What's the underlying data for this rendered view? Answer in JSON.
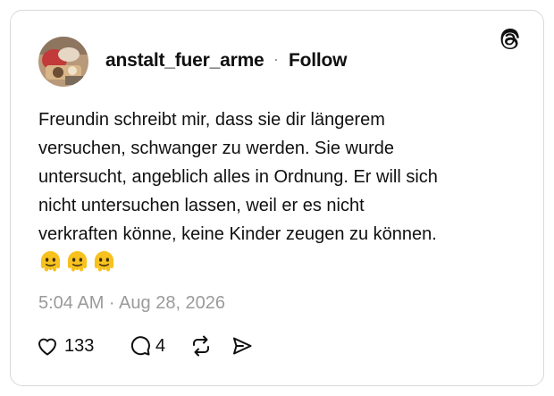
{
  "post": {
    "username": "anstalt_fuer_arme",
    "separator": "·",
    "follow_label": "Follow",
    "avatar_icon": "avatar-photo",
    "brand_icon": "threads-logo-icon",
    "text_lines": [
      "Freundin schreibt mir, dass sie dir längerem",
      "versuchen, schwanger zu werden. Sie wurde",
      "untersucht, angeblich alles in Ordnung. Er will sich",
      "nicht untersuchen lassen, weil er es nicht",
      "verkraften könne, keine Kinder zeugen zu können."
    ],
    "emojis": [
      "melting-face-emoji",
      "melting-face-emoji",
      "melting-face-emoji"
    ],
    "timestamp": "5:04 AM · Aug 28, 2026"
  },
  "actions": {
    "like_count": "133",
    "reply_count": "4",
    "like_icon": "heart-icon",
    "reply_icon": "speech-bubble-icon",
    "repost_icon": "repost-icon",
    "share_icon": "send-icon"
  },
  "colors": {
    "text": "#101010",
    "muted": "#9a9a9a",
    "border": "#d9d9d9",
    "emoji_yellow": "#f7c21e"
  }
}
